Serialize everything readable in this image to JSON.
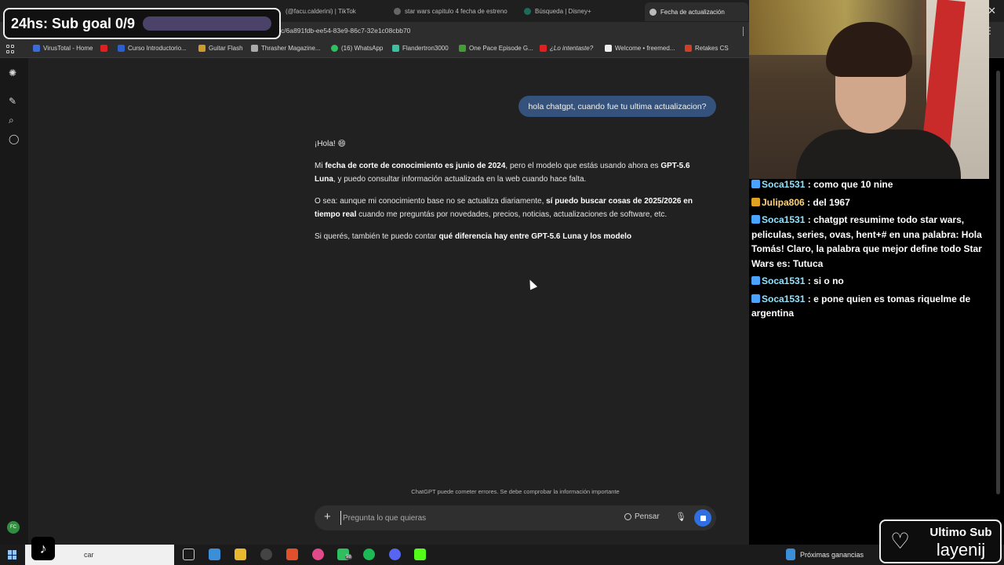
{
  "browser": {
    "tabs": [
      {
        "label": "(@facu.calderini) | TikTok",
        "active": false
      },
      {
        "label": "star wars capitulo 4 fecha de estreno",
        "active": false
      },
      {
        "label": "Búsqueda | Disney+",
        "active": false
      },
      {
        "label": "Fecha de actualización",
        "active": true
      }
    ],
    "url": "c/6a891fdb-ee54-83e9-86c7-32e1c08cbb70",
    "bookmarks": [
      "VirusTotal - Home",
      "Curso Introductorio...",
      "Guitar Flash",
      "Thrasher Magazine...",
      "(16) WhatsApp",
      "Flandertron3000",
      "One Pace Episode G...",
      "¿Lo intentaste?",
      "Welcome • freemed...",
      "Retakes CS"
    ]
  },
  "goal": {
    "text": "24hs: Sub goal 0/9",
    "progress": 0
  },
  "chat_page": {
    "user_message": "hola chatgpt, cuando fue tu ultima actualizacion?",
    "reply": {
      "greeting": "¡Hola! 😄",
      "p1_a": "Mi ",
      "p1_b": "fecha de corte de conocimiento es junio de 2024",
      "p1_c": ", pero el modelo que estás usando ahora es ",
      "p1_d": "GPT-5.6 Luna",
      "p1_e": ", y puedo consultar información actualizada en la web cuando hace falta.",
      "p2_a": "O sea: aunque mi conocimiento base no se actualiza diariamente, ",
      "p2_b": "sí puedo buscar cosas de 2025/2026 en tiempo real",
      "p2_c": " cuando me preguntás por novedades, precios, noticias, actualizaciones de software, etc.",
      "p3_a": "Si querés, también te puedo contar ",
      "p3_b": "qué diferencia hay entre GPT-5.6 Luna y los modelo"
    },
    "disclaimer": "ChatGPT puede cometer errores. Se debe comprobar la información importante",
    "composer": {
      "placeholder": "Pregunta lo que quieras",
      "pensar": "Pensar"
    },
    "avatar": "FC"
  },
  "stream_chat": [
    {
      "user": "Soca1531",
      "text": ": como que 10 nine",
      "badge": "blue"
    },
    {
      "user": "Julipa806",
      "text": ": del 1967",
      "badge": "gold"
    },
    {
      "user": "Soca1531",
      "text": ": chatgpt resumime todo star wars, peliculas, series, ovas, hent+# en una palabra: Hola Tomás! Claro, la palabra que mejor define todo Star Wars es: Tutuca",
      "badge": "blue"
    },
    {
      "user": "Soca1531",
      "text": ": si o no",
      "badge": "blue"
    },
    {
      "user": "Soca1531",
      "text": ": e pone quien es tomas riquelme de argentina",
      "badge": "blue"
    }
  ],
  "last_sub": {
    "label": "Ultimo Sub",
    "name": "layenij"
  },
  "taskbar": {
    "search": "car",
    "widget": "Próximas ganancias",
    "badge_count": "98"
  },
  "colors": {
    "bubble": "#34527b",
    "accent": "#2f6fe0",
    "chat_name": "#8ee3ff"
  }
}
